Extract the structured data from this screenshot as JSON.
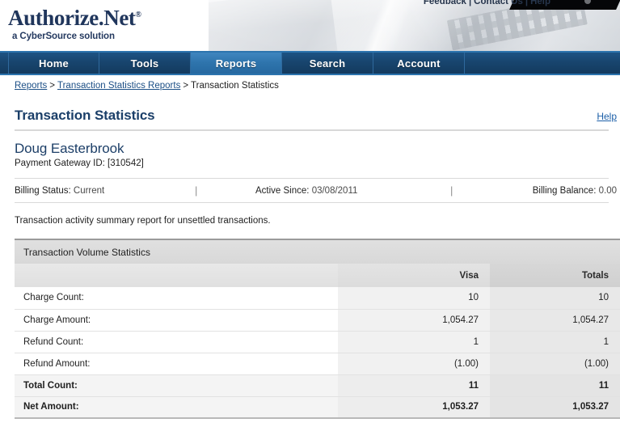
{
  "header": {
    "logo_main": "Authorize.Net",
    "logo_trademark": "®",
    "logo_sub": "a CyberSource solution",
    "util_links": [
      {
        "label": "Feedback"
      },
      {
        "label": "Contact Us"
      },
      {
        "label": "Help"
      }
    ],
    "util_separator": "|"
  },
  "nav": {
    "items": [
      {
        "label": "Home",
        "active": false
      },
      {
        "label": "Tools",
        "active": false
      },
      {
        "label": "Reports",
        "active": true
      },
      {
        "label": "Search",
        "active": false
      },
      {
        "label": "Account",
        "active": false
      }
    ]
  },
  "breadcrumb": {
    "items": [
      {
        "label": "Reports",
        "link": true
      },
      {
        "label": "Transaction Statistics Reports",
        "link": true
      },
      {
        "label": "Transaction Statistics",
        "link": false
      }
    ],
    "separator": ">"
  },
  "page": {
    "title": "Transaction Statistics",
    "help_label": "Help"
  },
  "account": {
    "name": "Doug Easterbrook",
    "gateway_label": "Payment Gateway ID: [310542]"
  },
  "status": {
    "billing_status_label": "Billing Status:",
    "billing_status_value": "Current",
    "active_since_label": "Active Since:",
    "active_since_value": "03/08/2011",
    "billing_balance_label": "Billing Balance:",
    "billing_balance_value": "0.00",
    "divider": "|"
  },
  "description": "Transaction activity summary report for unsettled transactions.",
  "table": {
    "section_title": "Transaction Volume Statistics",
    "columns": [
      {
        "label": ""
      },
      {
        "label": "Visa"
      },
      {
        "label": "Totals"
      }
    ],
    "rows": [
      {
        "label": "Charge Count:",
        "visa": "10",
        "totals": "10",
        "bold": false
      },
      {
        "label": "Charge Amount:",
        "visa": "1,054.27",
        "totals": "1,054.27",
        "bold": false
      },
      {
        "label": "Refund Count:",
        "visa": "1",
        "totals": "1",
        "bold": false
      },
      {
        "label": "Refund Amount:",
        "visa": "(1.00)",
        "totals": "(1.00)",
        "bold": false
      },
      {
        "label": "Total Count:",
        "visa": "11",
        "totals": "11",
        "bold": true
      },
      {
        "label": "Net Amount:",
        "visa": "1,053.27",
        "totals": "1,053.27",
        "bold": true
      }
    ]
  },
  "colors": {
    "brand_navy": "#20365c",
    "nav_blue": "#18456e",
    "nav_active_blue": "#2e74ac",
    "link_blue": "#1c5fa8",
    "title_blue": "#1b3f69"
  }
}
